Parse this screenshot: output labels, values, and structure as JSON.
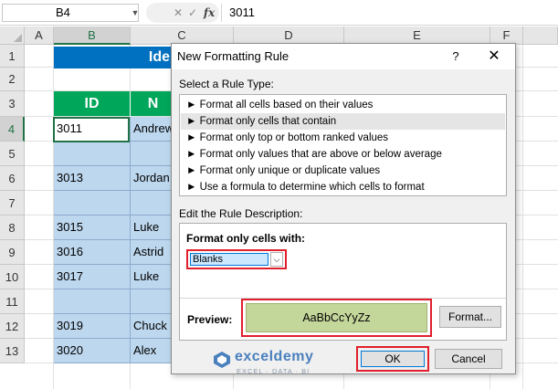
{
  "formula_bar": {
    "name_box": "B4",
    "fx_label": "fx",
    "cancel_glyph": "✕",
    "enter_glyph": "✓",
    "value": "3011"
  },
  "columns": [
    "A",
    "B",
    "C",
    "D",
    "E",
    "F"
  ],
  "rows": [
    "1",
    "2",
    "3",
    "4",
    "5",
    "6",
    "7",
    "8",
    "9",
    "10",
    "11",
    "12",
    "13"
  ],
  "sheet": {
    "title_partial": "Ide",
    "headers": {
      "id": "ID",
      "name_partial": "N"
    },
    "ids": [
      "3011",
      "",
      "3013",
      "",
      "3015",
      "3016",
      "3017",
      "",
      "3019",
      "3020"
    ],
    "names": [
      "Andrew",
      "",
      "Jordan",
      "",
      "Luke",
      "Astrid",
      "Luke",
      "",
      "Chuck",
      "Alex"
    ]
  },
  "dialog": {
    "title": "New Formatting Rule",
    "help": "?",
    "close": "✕",
    "select_rule_type_label": "Select a Rule Type:",
    "rule_types": [
      "► Format all cells based on their values",
      "► Format only cells that contain",
      "► Format only top or bottom ranked values",
      "► Format only values that are above or below average",
      "► Format only unique or duplicate values",
      "► Use a formula to determine which cells to format"
    ],
    "selected_rule_index": 1,
    "edit_description_label": "Edit the Rule Description:",
    "format_only_cells_with": "Format only cells with:",
    "condition_value": "Blanks",
    "preview_label": "Preview:",
    "preview_sample": "AaBbCcYyZz",
    "format_button": "Format...",
    "ok_button": "OK",
    "cancel_button": "Cancel"
  },
  "watermark": {
    "name": "exceldemy",
    "tagline": "EXCEL · DATA · BI"
  },
  "colors": {
    "title_fill": "#0070c0",
    "header_fill": "#00a65a",
    "data_fill": "#bdd7ee",
    "preview_fill": "#c4d79b",
    "highlight_red": "#e0202d",
    "excel_green": "#217346"
  }
}
